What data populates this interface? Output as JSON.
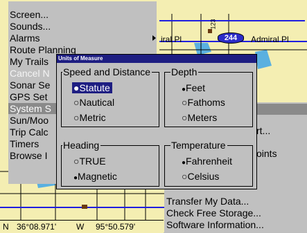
{
  "background_map": {
    "labels": [
      "Admiral Pl",
      "iral Pl",
      "244",
      "123"
    ]
  },
  "menu": {
    "items": [
      {
        "label": "Screen..."
      },
      {
        "label": "Sounds..."
      },
      {
        "label": "Alarms"
      },
      {
        "label": "Route Planning"
      },
      {
        "label": "My Trails"
      },
      {
        "label": "Cancel N"
      },
      {
        "label": "Sonar Se"
      },
      {
        "label": "GPS Set"
      },
      {
        "label": "System S"
      },
      {
        "label": "Sun/Moo"
      },
      {
        "label": "Trip Calc"
      },
      {
        "label": "Timers"
      },
      {
        "label": "Browse I"
      }
    ]
  },
  "submenu": {
    "items": [
      {
        "label": "rt..."
      },
      {
        "label": "oints"
      },
      {
        "label": "Transfer My Data..."
      },
      {
        "label": "Check Free Storage..."
      },
      {
        "label": "Software Information..."
      }
    ]
  },
  "status": {
    "lat_hemi": "N",
    "lat": "36°08.971'",
    "lon_hemi": "W",
    "lon": "95°50.579'"
  },
  "dialog": {
    "title": "Units of Measure",
    "speed": {
      "label": "Speed and Distance",
      "options": [
        "Statute",
        "Nautical",
        "Metric"
      ],
      "selected": "Statute"
    },
    "depth": {
      "label": "Depth",
      "options": [
        "Feet",
        "Fathoms",
        "Meters"
      ],
      "selected": "Feet"
    },
    "heading": {
      "label": "Heading",
      "options": [
        "TRUE",
        "Magnetic"
      ],
      "selected": "Magnetic"
    },
    "temperature": {
      "label": "Temperature",
      "options": [
        "Fahrenheit",
        "Celsius"
      ],
      "selected": "Fahrenheit"
    }
  },
  "colors": {
    "map": "#f4eeb2",
    "panel": "#c0c0c0",
    "title_bar": "#1e1e82",
    "highlight": "#8a8a8a",
    "disabled": "#f4f4f4"
  },
  "icons": {
    "filled_dot": "●",
    "empty_dot": "○",
    "submenu_arrow": "▶"
  }
}
